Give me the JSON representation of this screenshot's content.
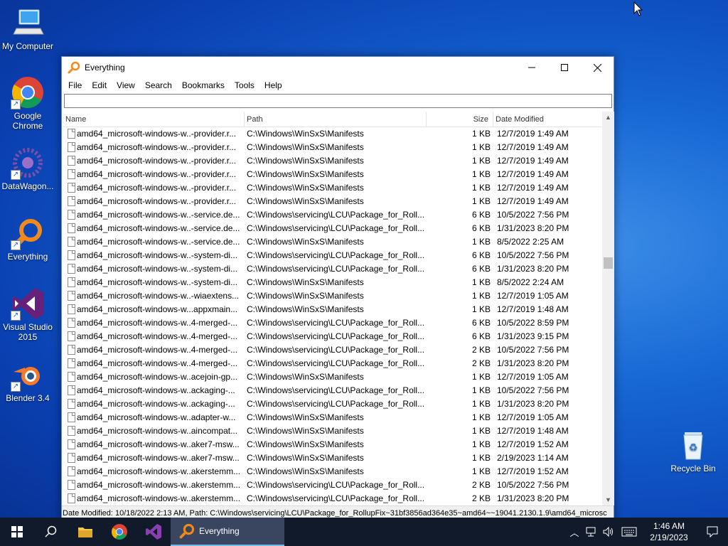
{
  "desktop": {
    "icons": [
      {
        "label": "My Computer"
      },
      {
        "label": "Google Chrome"
      },
      {
        "label": "DataWagon..."
      },
      {
        "label": "Everything"
      },
      {
        "label": "Visual Studio 2015"
      },
      {
        "label": "Blender 3.4"
      },
      {
        "label": "Recycle Bin"
      }
    ]
  },
  "window": {
    "title": "Everything",
    "menu": [
      "File",
      "Edit",
      "View",
      "Search",
      "Bookmarks",
      "Tools",
      "Help"
    ],
    "search_value": "",
    "columns": {
      "name": "Name",
      "path": "Path",
      "size": "Size",
      "modified": "Date Modified"
    },
    "rows": [
      {
        "name": "amd64_microsoft-windows-w..-provider.r...",
        "path": "C:\\Windows\\WinSxS\\Manifests",
        "size": "1 KB",
        "modified": "12/7/2019 1:49 AM"
      },
      {
        "name": "amd64_microsoft-windows-w..-provider.r...",
        "path": "C:\\Windows\\WinSxS\\Manifests",
        "size": "1 KB",
        "modified": "12/7/2019 1:49 AM"
      },
      {
        "name": "amd64_microsoft-windows-w..-provider.r...",
        "path": "C:\\Windows\\WinSxS\\Manifests",
        "size": "1 KB",
        "modified": "12/7/2019 1:49 AM"
      },
      {
        "name": "amd64_microsoft-windows-w..-provider.r...",
        "path": "C:\\Windows\\WinSxS\\Manifests",
        "size": "1 KB",
        "modified": "12/7/2019 1:49 AM"
      },
      {
        "name": "amd64_microsoft-windows-w..-provider.r...",
        "path": "C:\\Windows\\WinSxS\\Manifests",
        "size": "1 KB",
        "modified": "12/7/2019 1:49 AM"
      },
      {
        "name": "amd64_microsoft-windows-w..-provider.r...",
        "path": "C:\\Windows\\WinSxS\\Manifests",
        "size": "1 KB",
        "modified": "12/7/2019 1:49 AM"
      },
      {
        "name": "amd64_microsoft-windows-w..-service.de...",
        "path": "C:\\Windows\\servicing\\LCU\\Package_for_Roll...",
        "size": "6 KB",
        "modified": "10/5/2022 7:56 PM"
      },
      {
        "name": "amd64_microsoft-windows-w..-service.de...",
        "path": "C:\\Windows\\servicing\\LCU\\Package_for_Roll...",
        "size": "6 KB",
        "modified": "1/31/2023 8:20 PM"
      },
      {
        "name": "amd64_microsoft-windows-w..-service.de...",
        "path": "C:\\Windows\\WinSxS\\Manifests",
        "size": "1 KB",
        "modified": "8/5/2022 2:25 AM"
      },
      {
        "name": "amd64_microsoft-windows-w..-system-di...",
        "path": "C:\\Windows\\servicing\\LCU\\Package_for_Roll...",
        "size": "6 KB",
        "modified": "10/5/2022 7:56 PM"
      },
      {
        "name": "amd64_microsoft-windows-w..-system-di...",
        "path": "C:\\Windows\\servicing\\LCU\\Package_for_Roll...",
        "size": "6 KB",
        "modified": "1/31/2023 8:20 PM"
      },
      {
        "name": "amd64_microsoft-windows-w..-system-di...",
        "path": "C:\\Windows\\WinSxS\\Manifests",
        "size": "1 KB",
        "modified": "8/5/2022 2:24 AM"
      },
      {
        "name": "amd64_microsoft-windows-w..-wiaextens...",
        "path": "C:\\Windows\\WinSxS\\Manifests",
        "size": "1 KB",
        "modified": "12/7/2019 1:05 AM"
      },
      {
        "name": "amd64_microsoft-windows-w...appxmain...",
        "path": "C:\\Windows\\WinSxS\\Manifests",
        "size": "1 KB",
        "modified": "12/7/2019 1:48 AM"
      },
      {
        "name": "amd64_microsoft-windows-w..4-merged-...",
        "path": "C:\\Windows\\servicing\\LCU\\Package_for_Roll...",
        "size": "6 KB",
        "modified": "10/5/2022 8:59 PM"
      },
      {
        "name": "amd64_microsoft-windows-w..4-merged-...",
        "path": "C:\\Windows\\servicing\\LCU\\Package_for_Roll...",
        "size": "6 KB",
        "modified": "1/31/2023 9:15 PM"
      },
      {
        "name": "amd64_microsoft-windows-w..4-merged-...",
        "path": "C:\\Windows\\servicing\\LCU\\Package_for_Roll...",
        "size": "2 KB",
        "modified": "10/5/2022 7:56 PM"
      },
      {
        "name": "amd64_microsoft-windows-w..4-merged-...",
        "path": "C:\\Windows\\servicing\\LCU\\Package_for_Roll...",
        "size": "2 KB",
        "modified": "1/31/2023 8:20 PM"
      },
      {
        "name": "amd64_microsoft-windows-w..acejoin-gp...",
        "path": "C:\\Windows\\WinSxS\\Manifests",
        "size": "1 KB",
        "modified": "12/7/2019 1:05 AM"
      },
      {
        "name": "amd64_microsoft-windows-w..ackaging-...",
        "path": "C:\\Windows\\servicing\\LCU\\Package_for_Roll...",
        "size": "1 KB",
        "modified": "10/5/2022 7:56 PM"
      },
      {
        "name": "amd64_microsoft-windows-w..ackaging-...",
        "path": "C:\\Windows\\servicing\\LCU\\Package_for_Roll...",
        "size": "1 KB",
        "modified": "1/31/2023 8:20 PM"
      },
      {
        "name": "amd64_microsoft-windows-w..adapter-w...",
        "path": "C:\\Windows\\WinSxS\\Manifests",
        "size": "1 KB",
        "modified": "12/7/2019 1:05 AM"
      },
      {
        "name": "amd64_microsoft-windows-w..aincompat...",
        "path": "C:\\Windows\\WinSxS\\Manifests",
        "size": "1 KB",
        "modified": "12/7/2019 1:48 AM"
      },
      {
        "name": "amd64_microsoft-windows-w..aker7-msw...",
        "path": "C:\\Windows\\WinSxS\\Manifests",
        "size": "1 KB",
        "modified": "12/7/2019 1:52 AM"
      },
      {
        "name": "amd64_microsoft-windows-w..aker7-msw...",
        "path": "C:\\Windows\\WinSxS\\Manifests",
        "size": "1 KB",
        "modified": "2/19/2023 1:14 AM"
      },
      {
        "name": "amd64_microsoft-windows-w..akerstemm...",
        "path": "C:\\Windows\\WinSxS\\Manifests",
        "size": "1 KB",
        "modified": "12/7/2019 1:52 AM"
      },
      {
        "name": "amd64_microsoft-windows-w..akerstemm...",
        "path": "C:\\Windows\\servicing\\LCU\\Package_for_Roll...",
        "size": "2 KB",
        "modified": "10/5/2022 7:56 PM"
      },
      {
        "name": "amd64_microsoft-windows-w..akerstemm...",
        "path": "C:\\Windows\\servicing\\LCU\\Package_for_Roll...",
        "size": "2 KB",
        "modified": "1/31/2023 8:20 PM"
      }
    ],
    "status": "Date Modified: 10/18/2022 2:13 AM, Path: C:\\Windows\\servicing\\LCU\\Package_for_RollupFix~31bf3856ad364e35~amd64~~19041.2130.1.9\\amd64_microsc"
  },
  "taskbar": {
    "active_app": "Everything",
    "time": "1:46 AM",
    "date": "2/19/2023"
  },
  "colors": {
    "accent": "#76b9ed",
    "taskbar": "#101a2b",
    "desktop": "#1565d3"
  }
}
